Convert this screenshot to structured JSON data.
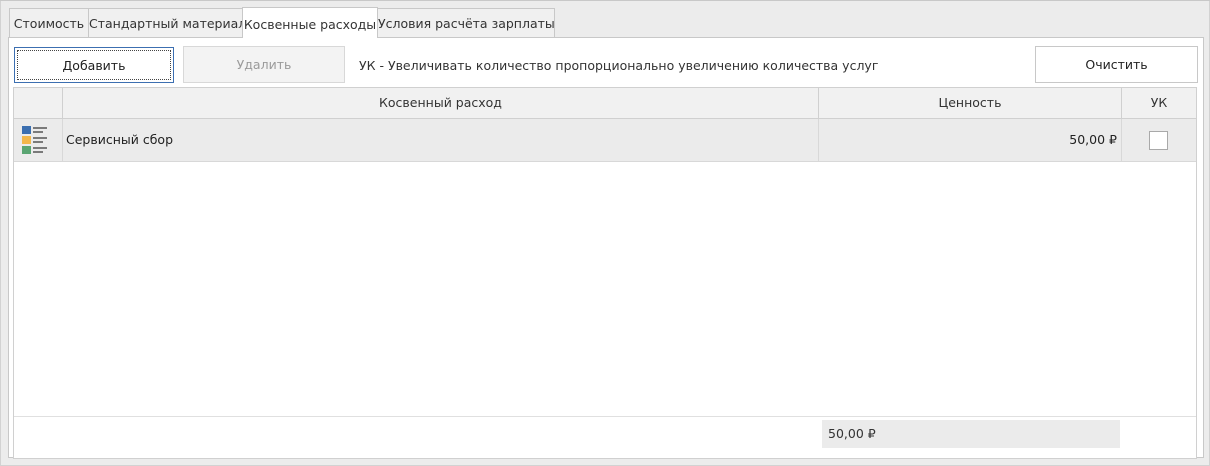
{
  "tabs": [
    {
      "label": "Стоимость"
    },
    {
      "label": "Стандартный материал"
    },
    {
      "label": "Косвенные расходы",
      "active": true
    },
    {
      "label": "Условия расчёта зарплаты"
    }
  ],
  "toolbar": {
    "add_label": "Добавить",
    "delete_label": "Удалить",
    "hint": "УК - Увеличивать количество пропорционально увеличению количества услуг",
    "clear_label": "Очистить"
  },
  "grid": {
    "columns": {
      "expense": "Косвенный расход",
      "value": "Ценность",
      "uk": "УК"
    },
    "rows": [
      {
        "icon": "list-item-icon",
        "name": "Сервисный сбор",
        "value": "50,00 ₽",
        "uk_checked": false
      }
    ],
    "total": "50,00 ₽"
  },
  "colors": {
    "accent_border": "#3c6fb1",
    "row_background": "#ebebeb",
    "header_background": "#f1f1f1"
  }
}
